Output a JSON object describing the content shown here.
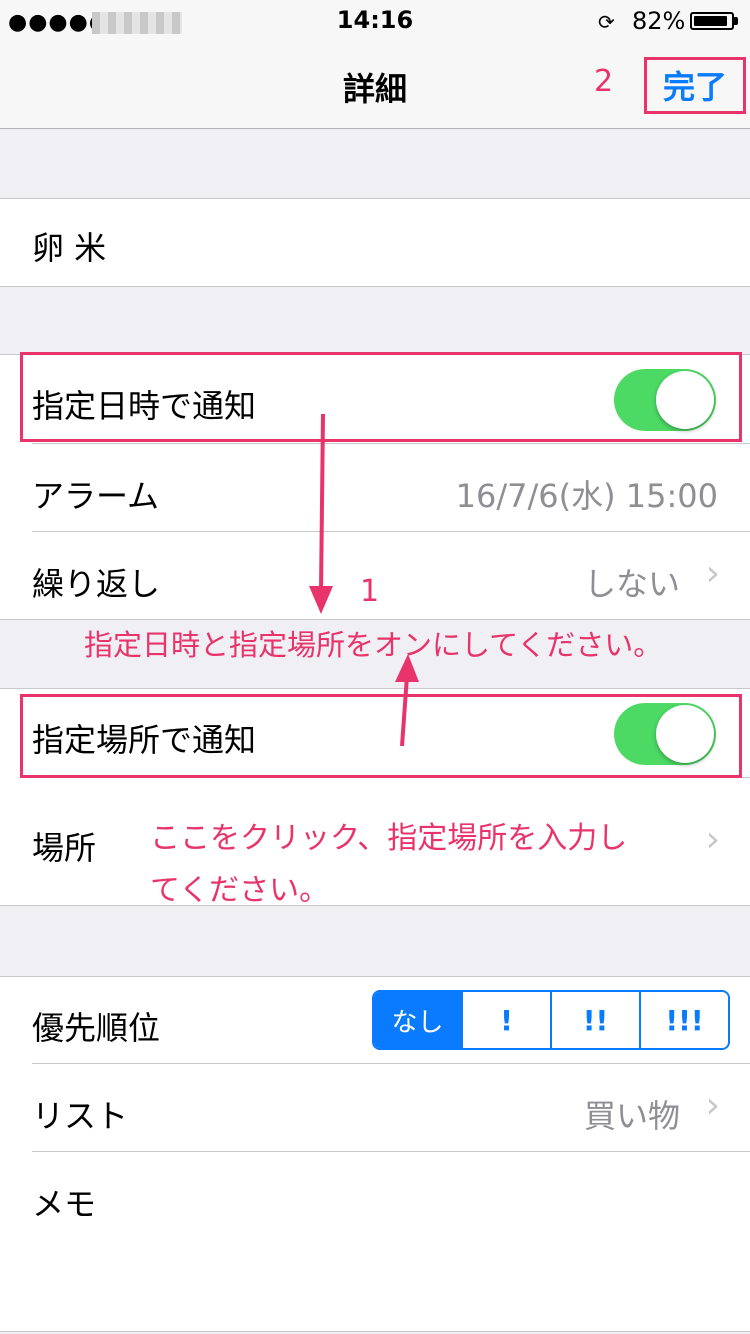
{
  "status_bar": {
    "signal": "●●●●●",
    "time": "14:16",
    "battery_percent": "82%",
    "battery_level": 0.82
  },
  "nav": {
    "title": "詳細",
    "done_label": "完了",
    "step_label": "2"
  },
  "item": {
    "title": "卵 米"
  },
  "notify_date": {
    "label": "指定日時で通知",
    "on": true
  },
  "alarm": {
    "label": "アラーム",
    "value": "16/7/6(水) 15:00"
  },
  "repeat": {
    "label": "繰り返し",
    "value": "しない"
  },
  "annotation1": {
    "step": "1",
    "text": "指定日時と指定場所をオンにしてください。"
  },
  "notify_location": {
    "label": "指定場所で通知",
    "on": true
  },
  "location": {
    "label": "場所",
    "hint_line1": "ここをクリック、指定場所を入力し",
    "hint_line2": "てください。"
  },
  "priority": {
    "label": "優先順位",
    "options": [
      "なし",
      "!",
      "!!",
      "!!!"
    ],
    "selected": "なし"
  },
  "list": {
    "label": "リスト",
    "value": "買い物"
  },
  "memo": {
    "label": "メモ"
  },
  "colors": {
    "accent": "#0a7bff",
    "annotation": "#e8336b",
    "toggle_on": "#4cd964"
  }
}
